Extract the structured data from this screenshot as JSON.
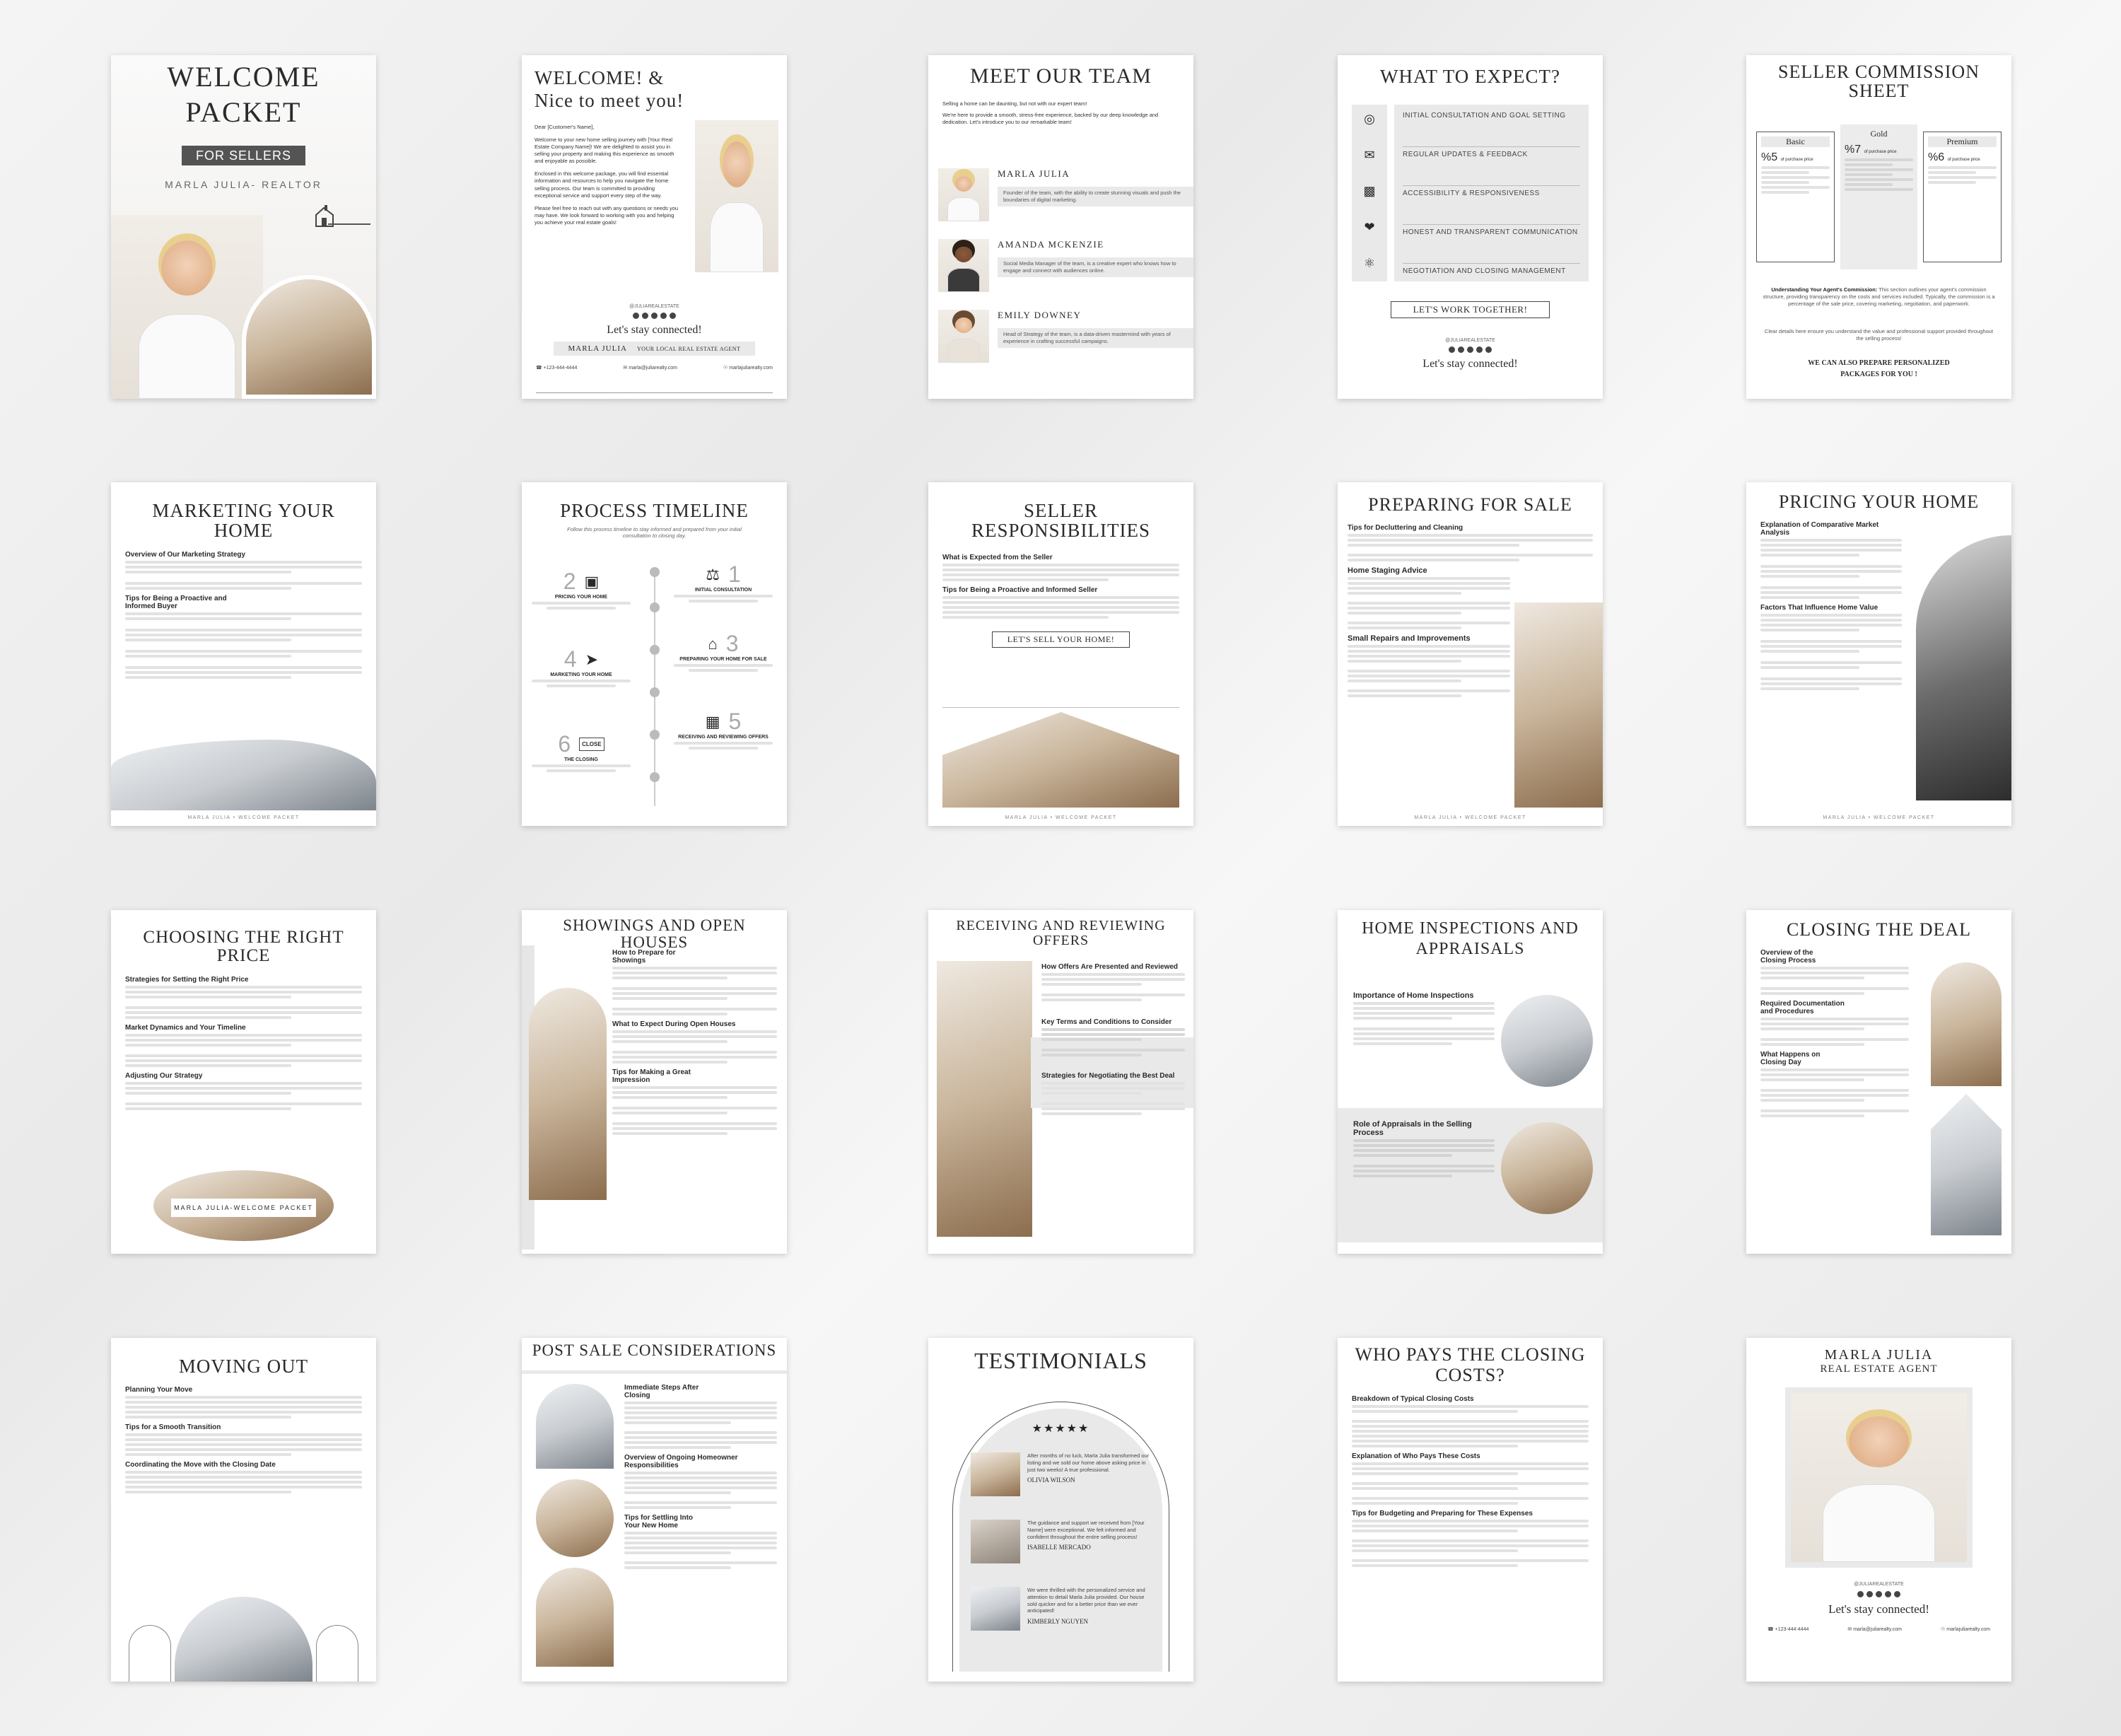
{
  "pages": {
    "welcome_packet": {
      "title_1": "WELCOME",
      "title_2": "PACKET",
      "badge": "FOR SELLERS",
      "subtitle": "MARLA JULIA- REALTOR"
    },
    "welcome_nice": {
      "title_1": "WELCOME! &",
      "title_2": "Nice to meet you!",
      "salutation": "Dear [Customer's Name],",
      "para_1": "Welcome to your new home selling journey with [Your Real Estate Company Name]! We are delighted to assist you in selling your property and making this experience as smooth and enjoyable as possible.",
      "para_2": "Enclosed in this welcome package, you will find essential information and resources to help you navigate the home selling process. Our team is committed to providing exceptional service and support every step of the way.",
      "para_3": "Please feel free to reach out with any questions or needs you may have. We look forward to working with you and helping you achieve your real estate goals!",
      "handle": "@JULIAREALESTATE",
      "connect": "Let's stay connected!",
      "name": "MARLA JULIA",
      "tagline": "YOUR LOCAL REAL ESTATE AGENT",
      "phone": "+123-444-4444",
      "email": "marla@juliarealty.com",
      "web": "marlajuliarealty.com"
    },
    "meet_team": {
      "title": "MEET OUR TEAM",
      "intro_1": "Selling a home can be daunting, but not with our expert team!",
      "intro_2": "We're here to provide a smooth, stress-free experience, backed by our deep knowledge and dedication. Let's introduce you to our remarkable team!",
      "members": [
        {
          "name": "MARLA JULIA",
          "bio": "Founder of the team, with the ability to create stunning visuals and push the boundaries of digital marketing."
        },
        {
          "name": "AMANDA MCKENZIE",
          "bio": "Social Media Manager of the team, is a creative expert who knows how to engage and connect with audiences online."
        },
        {
          "name": "EMILY DOWNEY",
          "bio": "Head of Strategy of the team, is a data-driven mastermind with years of experience in crafting successful campaigns."
        }
      ]
    },
    "what_expect": {
      "title": "WHAT TO EXPECT?",
      "items": [
        "INITIAL CONSULTATION AND GOAL SETTING",
        "REGULAR UPDATES & FEEDBACK",
        "ACCESSIBILITY & RESPONSIVENESS",
        "HONEST AND TRANSPARENT COMMUNICATION",
        "NEGOTIATION AND CLOSING MANAGEMENT"
      ],
      "button": "LET'S WORK TOGETHER!",
      "handle": "@JULIAREALESTATE",
      "connect": "Let's stay connected!"
    },
    "commission": {
      "title_1": "SELLER COMMISSION",
      "title_2": "SHEET",
      "tiers": [
        {
          "name": "Basic",
          "pct": "%5",
          "unit": "of purchase price"
        },
        {
          "name": "Gold",
          "pct": "%7",
          "unit": "of purchase price"
        },
        {
          "name": "Premium",
          "pct": "%6",
          "unit": "of purchase price"
        }
      ],
      "understanding_label": "Understanding Your Agent's Commission:",
      "understanding_text": "This section outlines your agent's commission structure, providing transparency on the costs and services included. Typically, the commission is a percentage of the sale price, covering marketing, negotiation, and paperwork.",
      "clear_text": "Clear details here ensure you understand the value and professional support provided throughout the selling process!",
      "packages_1": "WE CAN ALSO PREPARE PERSONALIZED",
      "packages_2": "PACKAGES FOR YOU !"
    },
    "marketing": {
      "title": "MARKETING YOUR HOME",
      "h1": "Overview of Our Marketing Strategy",
      "h2": "Tips for Being a Proactive and Informed Buyer",
      "footer": "MARLA JULIA • WELCOME PACKET"
    },
    "timeline": {
      "title": "PROCESS TIMELINE",
      "intro": "Follow this process timeline to stay informed and prepared from your initial consultation to closing day.",
      "steps": [
        {
          "num": "1",
          "label": "INITIAL CONSULTATION"
        },
        {
          "num": "2",
          "label": "PRICING YOUR HOME"
        },
        {
          "num": "3",
          "label": "PREPARING YOUR HOME FOR SALE"
        },
        {
          "num": "4",
          "label": "MARKETING YOUR HOME"
        },
        {
          "num": "5",
          "label": "RECEIVING AND REVIEWING OFFERS"
        },
        {
          "num": "6",
          "label": "THE CLOSING"
        }
      ],
      "close_sign": "CLOSE"
    },
    "seller_resp": {
      "title": "SELLER RESPONSIBILITIES",
      "h1": "What is Expected from the Seller",
      "h2": "Tips for Being a Proactive and Informed Seller",
      "button": "LET'S SELL YOUR HOME!",
      "footer": "MARLA JULIA • WELCOME PACKET"
    },
    "preparing": {
      "title": "PREPARING FOR SALE",
      "h1": "Tips for Decluttering and Cleaning",
      "h2": "Home Staging Advice",
      "h3": "Small Repairs and Improvements",
      "footer": "MARLA JULIA • WELCOME PACKET"
    },
    "pricing": {
      "title": "PRICING YOUR HOME",
      "h1": "Explanation of Comparative Market Analysis",
      "h2": "Factors That Influence Home Value",
      "footer": "MARLA JULIA • WELCOME PACKET"
    },
    "right_price": {
      "title": "CHOOSING THE RIGHT PRICE",
      "h1": "Strategies for Setting the Right Price",
      "h2": "Market Dynamics and Your Timeline",
      "h3": "Adjusting Our Strategy",
      "footer": "MARLA JULIA-WELCOME PACKET"
    },
    "showings": {
      "title": "SHOWINGS AND OPEN HOUSES",
      "h1": "How to Prepare for Showings",
      "h2": "What to Expect During Open Houses",
      "h3": "Tips for Making a Great Impression"
    },
    "offers": {
      "title": "RECEIVING AND REVIEWING OFFERS",
      "h1": "How Offers Are Presented and Reviewed",
      "h2": "Key Terms and Conditions to Consider",
      "h3": "Strategies for Negotiating the Best Deal"
    },
    "inspections": {
      "title_1": "HOME INSPECTIONS AND",
      "title_2": "APPRAISALS",
      "h1": "Importance of Home Inspections",
      "h2": "Role of Appraisals in the Selling Process"
    },
    "closing": {
      "title": "CLOSING THE DEAL",
      "h1": "Overview of the Closing Process",
      "h2": "Required Documentation and Procedures",
      "h3": "What Happens on Closing Day"
    },
    "moving": {
      "title": "MOVING OUT",
      "h1": "Planning Your Move",
      "h2": "Tips for a Smooth Transition",
      "h3": "Coordinating the Move with the Closing Date"
    },
    "post_sale": {
      "title": "POST SALE CONSIDERATIONS",
      "h1": "Immediate Steps After Closing",
      "h2": "Overview of Ongoing Homeowner Responsibilities",
      "h3": "Tips for Settling Into Your New Home"
    },
    "testimonials": {
      "title": "TESTIMONIALS",
      "stars": "★★★★★",
      "items": [
        {
          "quote": "After months of no luck, Marla Julia transformed our listing and we sold our home above asking price in just two weeks! A true professional.",
          "name": "OLIVIA WILSON"
        },
        {
          "quote": "The guidance and support we received from [Your Name] were exceptional. We felt informed and confident throughout the entire selling process!",
          "name": "ISABELLE MERCADO"
        },
        {
          "quote": "We were thrilled with the personalized service and attention to detail Marla Julia provided. Our house sold quicker and for a better price than we ever anticipated!",
          "name": "KIMBERLY NGUYEN"
        }
      ]
    },
    "who_pays": {
      "title_1": "WHO PAYS THE CLOSING",
      "title_2": "COSTS?",
      "h1": "Breakdown of Typical Closing Costs",
      "h2": "Explanation of Who Pays These Costs",
      "h3": "Tips for Budgeting and Preparing for These Expenses"
    },
    "agent": {
      "name": "MARLA JULIA",
      "role": "REAL ESTATE AGENT",
      "handle": "@JULIAREALESTATE",
      "connect": "Let's stay connected!",
      "phone": "+123-444-4444",
      "email": "marla@juliarealty.com",
      "web": "marlajuliarealty.com"
    }
  },
  "colors": {
    "accent": "#545454",
    "panel": "#e9e9e9",
    "text": "#2b2b2b"
  }
}
